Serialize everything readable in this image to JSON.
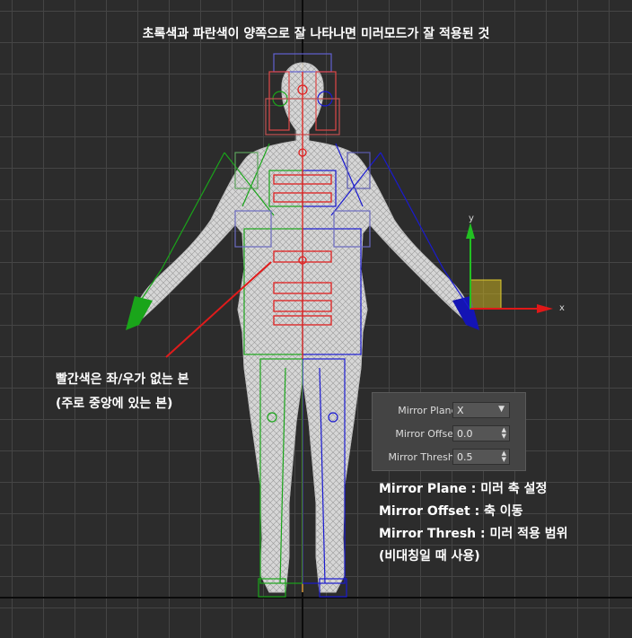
{
  "top_caption": "초록색과 파란색이 양쪽으로 잘 나타나면 미러모드가 잘 적용된 것",
  "note": {
    "line1": "빨간색은 좌/우가 없는 본",
    "line2": "(주로 중앙에 있는 본)"
  },
  "gizmo": {
    "y_label": "y",
    "x_label": "x"
  },
  "mirror_panel": {
    "plane_label": "Mirror Plane:",
    "plane_value": "X",
    "offset_label": "Mirror Offset:",
    "offset_value": "0.0",
    "thresh_label": "Mirror Thresh.:",
    "thresh_value": "0.5"
  },
  "legend": {
    "plane_term": "Mirror Plane",
    "plane_desc": " : 미러 축 설정",
    "offset_term": "Mirror Offset",
    "offset_desc": " : 축 이동",
    "thresh_term": "Mirror Thresh",
    "thresh_desc": " : 미러 적용 범위",
    "thresh_note": "(비대칭일 때 사용)"
  },
  "colors": {
    "left_side": "#1aa51a",
    "right_side": "#1414b4",
    "center_bone": "#e02020",
    "mesh": "#e8e8e8",
    "gizmo_y": "#20c020",
    "gizmo_x": "#e01818",
    "gizmo_plane": "#d8c020"
  }
}
